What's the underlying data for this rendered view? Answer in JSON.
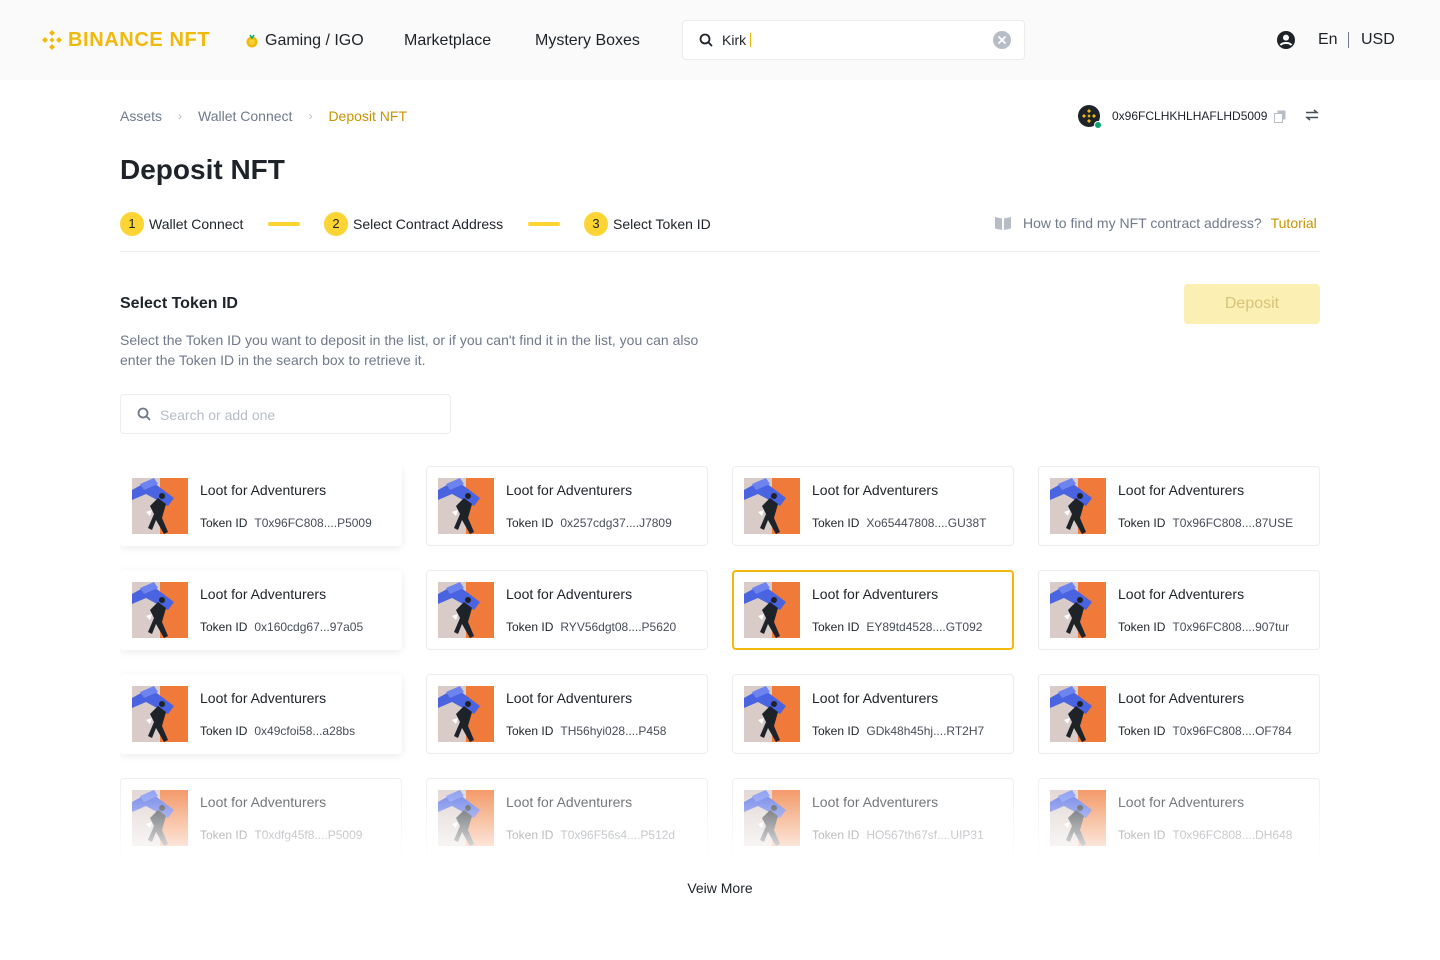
{
  "header": {
    "logo_text": "BINANCE NFT",
    "nav": {
      "gaming": "Gaming / IGO",
      "marketplace": "Marketplace",
      "mystery_boxes": "Mystery Boxes"
    },
    "search_value": "Kirk",
    "language": "En",
    "currency": "USD"
  },
  "breadcrumb": {
    "items": [
      "Assets",
      "Wallet Connect",
      "Deposit NFT"
    ]
  },
  "wallet": {
    "address": "0x96FCLHKHLHAFLHD5009"
  },
  "page_title": "Deposit NFT",
  "steps": [
    {
      "num": "1",
      "label": "Wallet Connect"
    },
    {
      "num": "2",
      "label": "Select Contract Address"
    },
    {
      "num": "3",
      "label": "Select Token ID"
    }
  ],
  "help": {
    "text": "How to find my NFT contract address?",
    "link": "Tutorial"
  },
  "section": {
    "title": "Select Token ID",
    "deposit_label": "Deposit",
    "description": "Select the Token ID you want to deposit in the list, or if you can't find it in the list, you can also enter the Token ID in the search box to retrieve it.",
    "search_placeholder": "Search or add one"
  },
  "token_id_label": "Token ID",
  "cards": [
    {
      "title": "Loot for Adventurers",
      "token_id": "T0x96FC808....P5009"
    },
    {
      "title": "Loot for Adventurers",
      "token_id": "0x257cdg37....J7809"
    },
    {
      "title": "Loot for Adventurers",
      "token_id": "Xo65447808....GU38T"
    },
    {
      "title": "Loot for Adventurers",
      "token_id": "T0x96FC808....87USE"
    },
    {
      "title": "Loot for Adventurers",
      "token_id": "0x160cdg67...97a05"
    },
    {
      "title": "Loot for Adventurers",
      "token_id": "RYV56dgt08....P5620"
    },
    {
      "title": "Loot for Adventurers",
      "token_id": "EY89td4528....GT092",
      "selected": true
    },
    {
      "title": "Loot for Adventurers",
      "token_id": "T0x96FC808....907tur"
    },
    {
      "title": "Loot for Adventurers",
      "token_id": "0x49cfoi58...a28bs"
    },
    {
      "title": "Loot for Adventurers",
      "token_id": "TH56hyi028....P458"
    },
    {
      "title": "Loot for Adventurers",
      "token_id": "GDk48h45hj....RT2H7"
    },
    {
      "title": "Loot for Adventurers",
      "token_id": "T0x96FC808....OF784"
    },
    {
      "title": "Loot for Adventurers",
      "token_id": "T0xdfg45f8....P5009"
    },
    {
      "title": "Loot for Adventurers",
      "token_id": "T0x96F56s4....P512d"
    },
    {
      "title": "Loot for Adventurers",
      "token_id": "HO567th67sf....UIP31"
    },
    {
      "title": "Loot for Adventurers",
      "token_id": "T0x96FC808....DH648"
    }
  ],
  "view_more": "Veiw More",
  "colors": {
    "brand": "#F0B90B",
    "step_yellow": "#FCD535",
    "link": "#C99400",
    "art_orange": "#F07A3A",
    "art_blue": "#4A63E0"
  }
}
